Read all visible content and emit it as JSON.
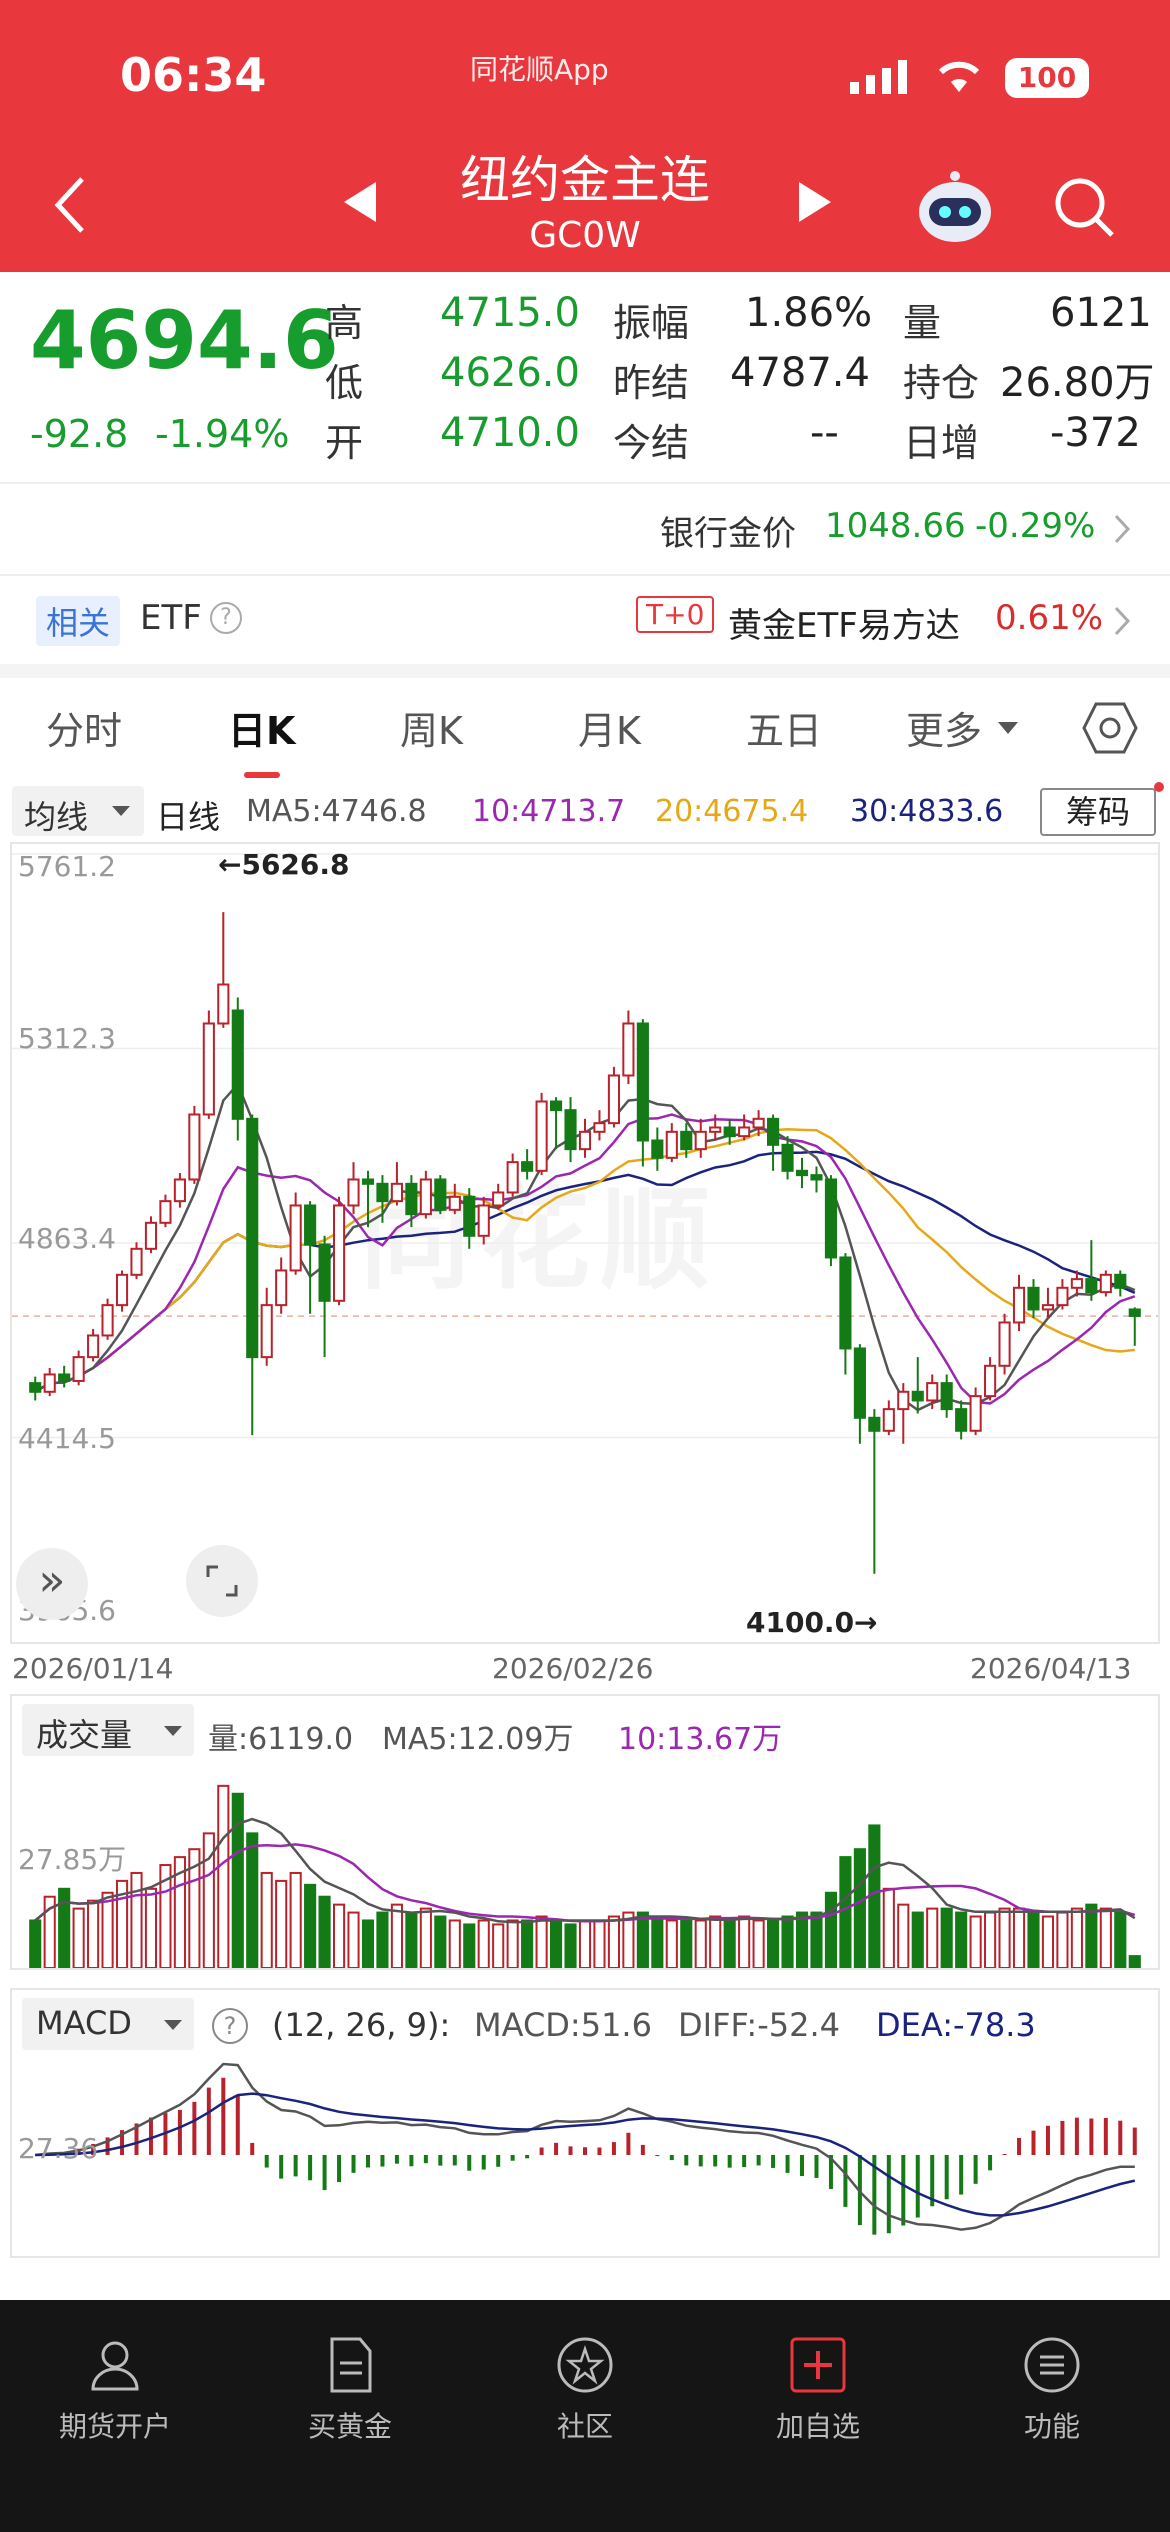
{
  "status": {
    "time": "06:34",
    "app": "同花顺App",
    "battery": "100"
  },
  "header": {
    "title": "纽约金主连",
    "code": "GC0W"
  },
  "quote": {
    "price": "4694.6",
    "change": "-92.8",
    "change_pct": "-1.94%",
    "high_label": "高",
    "high": "4715.0",
    "low_label": "低",
    "low": "4626.0",
    "open_label": "开",
    "open": "4710.0",
    "amp_label": "振幅",
    "amp": "1.86%",
    "prev_label": "昨结",
    "prev": "4787.4",
    "settle_label": "今结",
    "settle": "--",
    "vol_label": "量",
    "vol": "6121",
    "oi_label": "持仓",
    "oi": "26.80万",
    "daily_label": "日增",
    "daily": "-372"
  },
  "bank": {
    "label": "银行金价",
    "price": "1048.66",
    "pct": "-0.29%"
  },
  "related": {
    "tag": "相关",
    "etf": "ETF",
    "badge": "T+0",
    "name": "黄金ETF易方达",
    "pct": "0.61%"
  },
  "tabs": [
    "分时",
    "日K",
    "周K",
    "月K",
    "五日",
    "更多"
  ],
  "ma_legend": {
    "dropdown": "均线",
    "period": "日线",
    "ma5": "MA5:4746.8",
    "ma10": "10:4713.7",
    "ma20": "20:4675.4",
    "ma30": "30:4833.6",
    "chip": "筹码"
  },
  "axis": {
    "y_labels": [
      "5761.2",
      "5312.3",
      "4863.4",
      "4414.5",
      "3965.6"
    ],
    "dates": [
      "2026/01/14",
      "2026/02/26",
      "2026/04/13"
    ],
    "hi_note": "←5626.8",
    "lo_note": "4100.0→"
  },
  "volume": {
    "dropdown": "成交量",
    "vol": "量:6119.0",
    "ma5": "MA5:12.09万",
    "ma10": "10:13.67万",
    "axis": "27.85万"
  },
  "macd": {
    "dropdown": "MACD",
    "params": "(12, 26, 9):",
    "macd": "MACD:51.6",
    "diff": "DIFF:-52.4",
    "dea": "DEA:-78.3",
    "axis": "27.36"
  },
  "nav": [
    "期货开户",
    "买黄金",
    "社区",
    "加自选",
    "功能"
  ],
  "colors": {
    "up": "#b8222b",
    "down": "#137a16",
    "ma5": "#555555",
    "ma10": "#9c27b0",
    "ma20": "#e6a817",
    "ma30": "#1a237e"
  },
  "chart_data": {
    "type": "candlestick",
    "ylim": [
      3965.6,
      5761.2
    ],
    "candles": [
      [
        4540,
        4520,
        4555,
        4500
      ],
      [
        4520,
        4560,
        4575,
        4510
      ],
      [
        4560,
        4545,
        4580,
        4530
      ],
      [
        4545,
        4600,
        4615,
        4535
      ],
      [
        4600,
        4650,
        4665,
        4590
      ],
      [
        4650,
        4720,
        4735,
        4640
      ],
      [
        4720,
        4790,
        4800,
        4705
      ],
      [
        4790,
        4850,
        4865,
        4780
      ],
      [
        4850,
        4910,
        4925,
        4840
      ],
      [
        4910,
        4960,
        4975,
        4900
      ],
      [
        4960,
        5010,
        5025,
        4945
      ],
      [
        5010,
        5160,
        5180,
        5000
      ],
      [
        5160,
        5370,
        5400,
        5150
      ],
      [
        5370,
        5460,
        5627,
        5360
      ],
      [
        5400,
        5150,
        5430,
        5100
      ],
      [
        5150,
        4600,
        5160,
        4420
      ],
      [
        4600,
        4720,
        4760,
        4580
      ],
      [
        4720,
        4800,
        4830,
        4700
      ],
      [
        4800,
        4950,
        4980,
        4790
      ],
      [
        4950,
        4860,
        4960,
        4700
      ],
      [
        4860,
        4730,
        4880,
        4600
      ],
      [
        4730,
        4950,
        4970,
        4720
      ],
      [
        4950,
        5010,
        5050,
        4930
      ],
      [
        5010,
        5000,
        5030,
        4900
      ],
      [
        5000,
        4960,
        5020,
        4910
      ],
      [
        4960,
        5000,
        5050,
        4950
      ],
      [
        5000,
        4930,
        5020,
        4900
      ],
      [
        4930,
        5010,
        5030,
        4920
      ],
      [
        5010,
        4940,
        5020,
        4930
      ],
      [
        4940,
        4970,
        5000,
        4930
      ],
      [
        4970,
        4880,
        4990,
        4850
      ],
      [
        4880,
        4950,
        4970,
        4860
      ],
      [
        4950,
        4980,
        5000,
        4940
      ],
      [
        4980,
        5050,
        5070,
        4970
      ],
      [
        5050,
        5030,
        5080,
        5010
      ],
      [
        5030,
        5190,
        5210,
        5020
      ],
      [
        5190,
        5170,
        5200,
        5080
      ],
      [
        5170,
        5080,
        5200,
        5050
      ],
      [
        5080,
        5120,
        5150,
        5060
      ],
      [
        5120,
        5140,
        5170,
        5100
      ],
      [
        5140,
        5250,
        5270,
        5130
      ],
      [
        5250,
        5370,
        5400,
        5230
      ],
      [
        5370,
        5100,
        5380,
        5040
      ],
      [
        5100,
        5060,
        5130,
        5030
      ],
      [
        5060,
        5120,
        5140,
        5050
      ],
      [
        5120,
        5080,
        5140,
        5060
      ],
      [
        5080,
        5120,
        5150,
        5060
      ],
      [
        5120,
        5130,
        5160,
        5100
      ],
      [
        5130,
        5110,
        5150,
        5090
      ],
      [
        5110,
        5130,
        5160,
        5100
      ],
      [
        5130,
        5150,
        5170,
        5110
      ],
      [
        5150,
        5090,
        5160,
        5030
      ],
      [
        5090,
        5030,
        5110,
        5010
      ],
      [
        5030,
        5020,
        5060,
        4990
      ],
      [
        5020,
        5010,
        5040,
        4980
      ],
      [
        5010,
        4830,
        5020,
        4810
      ],
      [
        4830,
        4620,
        4840,
        4560
      ],
      [
        4620,
        4460,
        4630,
        4400
      ],
      [
        4460,
        4430,
        4480,
        4100
      ],
      [
        4430,
        4480,
        4500,
        4420
      ],
      [
        4480,
        4520,
        4540,
        4400
      ],
      [
        4520,
        4500,
        4600,
        4470
      ],
      [
        4500,
        4540,
        4560,
        4480
      ],
      [
        4540,
        4480,
        4560,
        4460
      ],
      [
        4480,
        4430,
        4500,
        4410
      ],
      [
        4430,
        4510,
        4530,
        4420
      ],
      [
        4510,
        4580,
        4600,
        4500
      ],
      [
        4580,
        4680,
        4700,
        4560
      ],
      [
        4680,
        4760,
        4790,
        4660
      ],
      [
        4760,
        4710,
        4780,
        4690
      ],
      [
        4710,
        4720,
        4760,
        4690
      ],
      [
        4720,
        4760,
        4780,
        4710
      ],
      [
        4760,
        4780,
        4800,
        4740
      ],
      [
        4780,
        4750,
        4870,
        4730
      ],
      [
        4750,
        4790,
        4800,
        4740
      ],
      [
        4790,
        4760,
        4800,
        4740
      ],
      [
        4710,
        4695,
        4715,
        4626
      ]
    ],
    "volume": [
      12,
      18,
      20,
      15,
      17,
      19,
      22,
      24,
      20,
      26,
      28,
      30,
      34,
      46,
      44,
      34,
      24,
      22,
      24,
      21,
      18,
      16,
      14,
      12,
      14,
      16,
      14,
      15,
      13,
      12,
      11,
      12,
      11,
      12,
      12,
      13,
      12,
      11,
      12,
      12,
      13,
      14,
      14,
      12,
      12,
      12,
      12,
      13,
      12,
      13,
      12,
      12,
      13,
      14,
      14,
      19,
      28,
      30,
      36,
      20,
      16,
      14,
      15,
      15,
      14,
      13,
      14,
      15,
      15,
      14,
      13,
      14,
      15,
      16,
      15,
      14,
      3
    ]
  }
}
